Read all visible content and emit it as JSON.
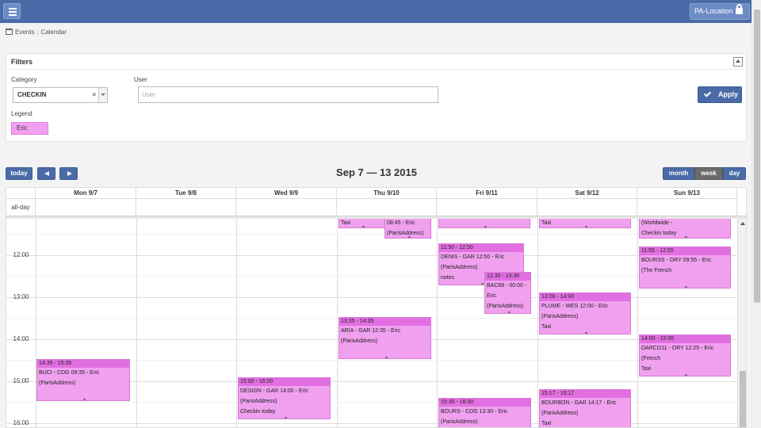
{
  "topbar": {
    "location_label": "PA-Location"
  },
  "breadcrumb": {
    "events": "Events",
    "calendar": "Calendar"
  },
  "filters": {
    "title": "Filters",
    "category_label": "Category",
    "category_value": "CHECKIN",
    "category_clear": "×",
    "user_label": "User",
    "user_placeholder": "User",
    "user_value": "",
    "apply_label": "Apply",
    "legend_label": "Legend",
    "legend_items": [
      "Eric"
    ],
    "legend_color": "#f0a0ef"
  },
  "toolbar": {
    "today": "today",
    "range_title": "Sep 7 — 13 2015",
    "views": [
      "month",
      "week",
      "day"
    ],
    "active_view": "week"
  },
  "calendar": {
    "days": [
      "Mon 9/7",
      "Tue 9/8",
      "Wed 9/9",
      "Thu 9/10",
      "Fri 9/11",
      "Sat 9/12",
      "Sun 9/13"
    ],
    "allday_label": "all-day",
    "hours": [
      "12:00",
      "13:00",
      "14:00",
      "15:00",
      "16:00"
    ],
    "event_color": "#f0a0ef",
    "event_title_color": "#e26fe1",
    "events": [
      {
        "day": 3,
        "time": "",
        "lines": [
          "Taxi"
        ]
      },
      {
        "day": 3,
        "time": "",
        "lines": [
          "08:45 - Eric",
          "(ParisAddress)"
        ]
      },
      {
        "day": 4,
        "time": "",
        "lines": []
      },
      {
        "day": 5,
        "time": "",
        "lines": [
          "Taxi"
        ]
      },
      {
        "day": 6,
        "time": "",
        "lines": [
          "(Worldwide -",
          "Checkin today"
        ]
      },
      {
        "day": 4,
        "time": "11:50 - 12:50",
        "lines": [
          "DENIS - GAR 12:50 - Eric",
          "(ParisAddress)",
          "notes"
        ]
      },
      {
        "day": 4,
        "time": "12:30 - 13:30",
        "lines": [
          "BAC68 - 00:00 -",
          "Eric",
          "(ParisAddress)"
        ]
      },
      {
        "day": 6,
        "time": "11:55 - 12:55",
        "lines": [
          "BOURSS - ORY 09:55 - Eric",
          "(The French"
        ]
      },
      {
        "day": 5,
        "time": "13:00 - 14:00",
        "lines": [
          "PLUME - WES 12:00 - Eric",
          "(ParisAddress)",
          "Taxi"
        ]
      },
      {
        "day": 3,
        "time": "13:35 - 14:35",
        "lines": [
          "ARIA - GAR 12:35 - Eric",
          "(ParisAddress)"
        ]
      },
      {
        "day": 6,
        "time": "14:00 - 15:00",
        "lines": [
          "DARCO11 - ORY 12:25 - Eric",
          "(French",
          "Taxi"
        ]
      },
      {
        "day": 0,
        "time": "14:35 - 15:35",
        "lines": [
          "BUCI - CDG 09:35 - Eric",
          "(ParisAddress)"
        ]
      },
      {
        "day": 2,
        "time": "15:00 - 16:00",
        "lines": [
          "DESIGN - GAR 14:00 - Eric",
          "(ParisAddress)",
          "Checkin today"
        ]
      },
      {
        "day": 5,
        "time": "15:17 - 16:17",
        "lines": [
          "BOURBON - GAR 14:17 - Eric",
          "(ParisAddress)",
          "Taxi"
        ]
      },
      {
        "day": 4,
        "time": "15:30 - 16:30",
        "lines": [
          "BOURS - CDG 13:30 - Eric",
          "(ParisAddress)"
        ]
      }
    ]
  }
}
